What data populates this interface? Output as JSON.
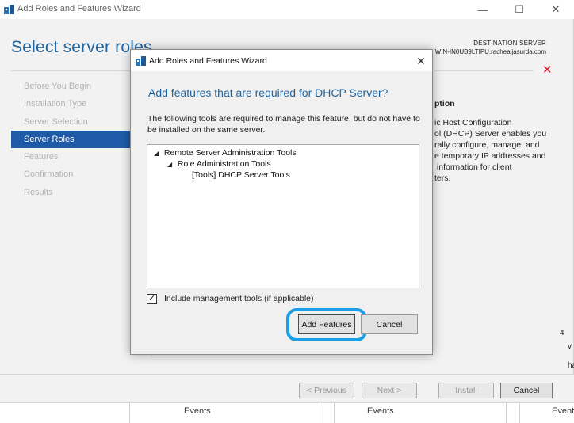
{
  "window": {
    "title": "Add Roles and Features Wizard",
    "minimize_glyph": "—",
    "maximize_glyph": "☐",
    "close_glyph": "✕"
  },
  "page": {
    "title": "Select server roles",
    "destination_label": "DESTINATION SERVER",
    "destination_server": "WIN-IN0UB9LTIPU.rachealjasurda.com",
    "error_glyph": "✕"
  },
  "nav": {
    "items": [
      {
        "label": "Before You Begin",
        "active": false
      },
      {
        "label": "Installation Type",
        "active": false
      },
      {
        "label": "Server Selection",
        "active": false
      },
      {
        "label": "Server Roles",
        "active": true
      },
      {
        "label": "Features",
        "active": false
      },
      {
        "label": "Confirmation",
        "active": false
      },
      {
        "label": "Results",
        "active": false
      }
    ]
  },
  "description": {
    "title": "ption",
    "lines": [
      "ic Host Configuration",
      "ol (DHCP) Server enables you",
      "rally configure, manage, and",
      "e temporary IP addresses and",
      " information for client",
      "ters."
    ]
  },
  "buttons": {
    "previous": "< Previous",
    "next": "Next >",
    "install": "Install",
    "cancel": "Cancel"
  },
  "events": {
    "cells": [
      "Events",
      "Events",
      "Event"
    ]
  },
  "partial_right": [
    "4",
    "v",
    "ha"
  ],
  "dialog": {
    "title": "Add Roles and Features Wizard",
    "close_glyph": "✕",
    "heading": "Add features that are required for DHCP Server?",
    "description": "The following tools are required to manage this feature, but do not have to be installed on the same server.",
    "tree": [
      {
        "label": "Remote Server Administration Tools",
        "level": 0,
        "arrow": "◢"
      },
      {
        "label": "Role Administration Tools",
        "level": 1,
        "arrow": "◢"
      },
      {
        "label": "[Tools] DHCP Server Tools",
        "level": 2,
        "arrow": ""
      }
    ],
    "include_mgmt_label": "Include management tools (if applicable)",
    "include_mgmt_checked": true,
    "check_glyph": "✓",
    "add_features_label": "Add Features",
    "cancel_label": "Cancel"
  },
  "colors": {
    "accent": "#1e64a0",
    "nav_active": "#1f5aa8",
    "highlight_ring": "#1aa0e8",
    "error": "#e81123"
  }
}
